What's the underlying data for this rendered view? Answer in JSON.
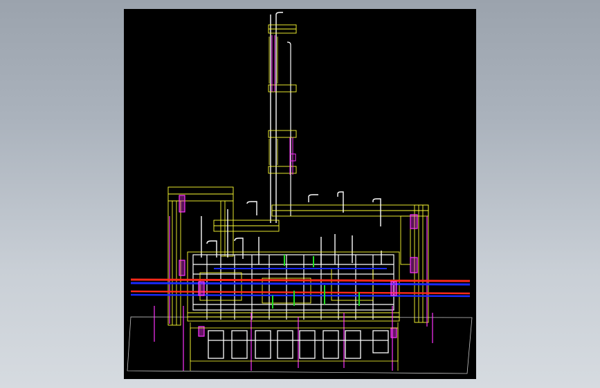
{
  "viewport": {
    "background": "#000000",
    "page_background_top": "#9ba3ad",
    "page_background_bottom": "#d6dbe0"
  },
  "drawing": {
    "content_type": "industrial-plant-3d-wireframe",
    "colors": {
      "structure": "#ffff33",
      "piping": "#ffffff",
      "supports": "#ff33ff",
      "hot_line": "#ff2a1a",
      "cold_line": "#1a2aff",
      "valves": "#22dd22",
      "ground_plane": "#c8c8c8"
    }
  }
}
